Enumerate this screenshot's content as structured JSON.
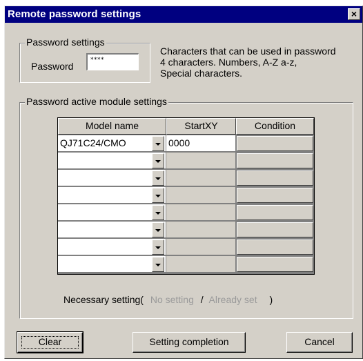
{
  "window": {
    "title": "Remote password settings",
    "close_glyph": "×"
  },
  "password_group": {
    "label": "Password settings",
    "password_label": "Password",
    "password_value": "****",
    "info_lines": [
      "Characters that can be used in password",
      " 4 characters. Numbers, A-Z a-z,",
      "Special characters."
    ]
  },
  "module_group": {
    "label": "Password active module settings",
    "columns": [
      "Model name",
      "StartXY",
      "Condition"
    ],
    "rows": [
      {
        "model": "QJ71C24/CMO",
        "startxy": "0000",
        "active": true
      },
      {
        "model": "",
        "startxy": "",
        "active": false
      },
      {
        "model": "",
        "startxy": "",
        "active": false
      },
      {
        "model": "",
        "startxy": "",
        "active": false
      },
      {
        "model": "",
        "startxy": "",
        "active": false
      },
      {
        "model": "",
        "startxy": "",
        "active": false
      },
      {
        "model": "",
        "startxy": "",
        "active": false
      },
      {
        "model": "",
        "startxy": "",
        "active": false
      }
    ],
    "dropdown_icon": "chevron-down-icon"
  },
  "legend": {
    "prefix": "Necessary setting(",
    "no_setting": "No setting",
    "separator": "/",
    "already_set": "Already set",
    "suffix": ")"
  },
  "buttons": {
    "clear": "Clear",
    "setting_completion": "Setting completion",
    "cancel": "Cancel"
  },
  "colors": {
    "titlebar": "#000080",
    "face": "#d4d0c8",
    "dim_text": "#9a9a9a"
  }
}
